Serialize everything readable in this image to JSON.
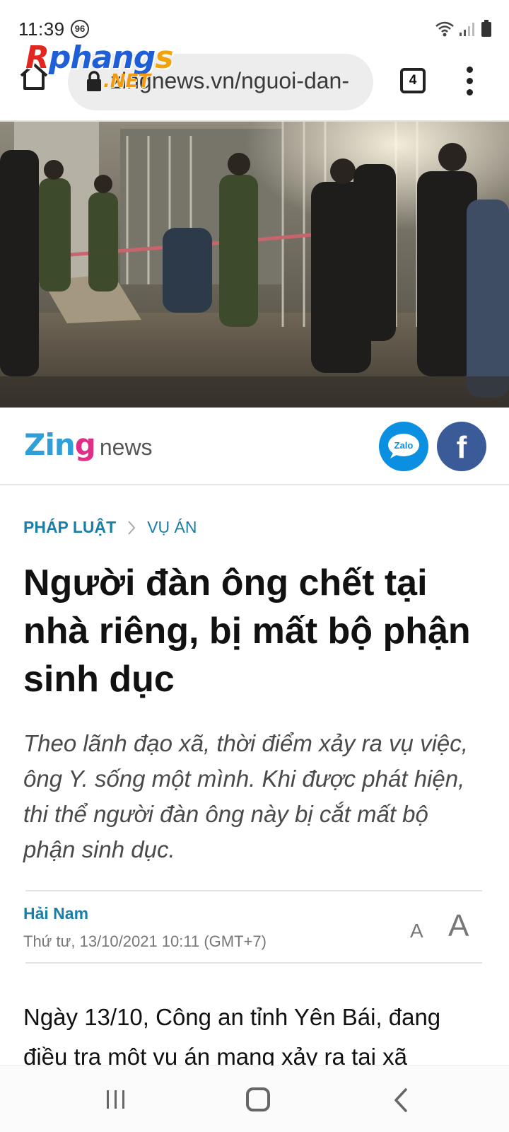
{
  "status_bar": {
    "time": "11:39",
    "badge": "96",
    "icons": [
      "wifi-icon",
      "signal-icon",
      "battery-icon"
    ]
  },
  "browser": {
    "url": "zingnews.vn/nguoi-dan-",
    "tab_count": "4",
    "icons": [
      "home-icon",
      "lock-icon",
      "tabs-icon",
      "more-vert-icon"
    ]
  },
  "watermark": {
    "main": "Rphangs",
    "sub": ".NET"
  },
  "brand": {
    "logo_word": "Zing",
    "logo_suffix": "news",
    "zalo_label": "Zalo",
    "facebook_label": "f",
    "colors": {
      "zing_blue": "#2f9fd8",
      "zing_pink": "#e12d8a",
      "zalo": "#0b8fe0",
      "facebook": "#3a5a98"
    }
  },
  "article": {
    "breadcrumb": [
      "PHÁP LUẬT",
      "VỤ ÁN"
    ],
    "headline": "Người đàn ông chết tại nhà riêng, bị mất bộ phận sinh dục",
    "sapo": "Theo lãnh đạo xã, thời điểm xảy ra vụ việc, ông Y. sống một mình. Khi được phát hiện, thi thể người đàn ông này bị cắt mất bộ phận sinh dục.",
    "author": "Hải Nam",
    "date": "Thứ tư, 13/10/2021 10:11 (GMT+7)",
    "font_small": "A",
    "font_large": "A",
    "body": "Ngày 13/10, Công an tỉnh Yên Bái, đang điều tra một vụ án mạng xảy ra tại xã",
    "accent_color": "#1a7fa8"
  },
  "nav_bar": {
    "buttons": [
      "recent-apps",
      "home",
      "back"
    ]
  }
}
